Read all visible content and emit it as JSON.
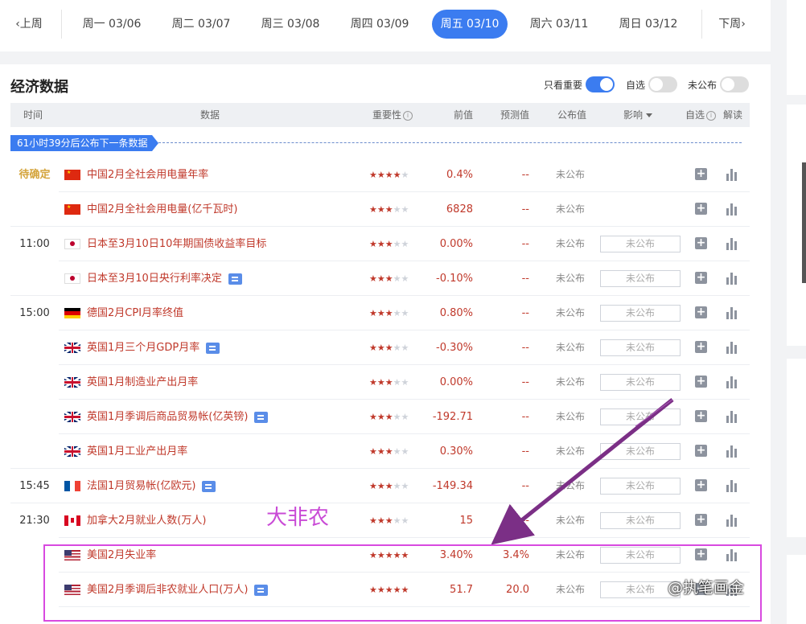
{
  "week_nav": {
    "prev": "上周",
    "next": "下周",
    "days": [
      {
        "label": "周一 03/06",
        "active": false
      },
      {
        "label": "周二 03/07",
        "active": false
      },
      {
        "label": "周三 03/08",
        "active": false
      },
      {
        "label": "周四 03/09",
        "active": false
      },
      {
        "label": "周五 03/10",
        "active": true
      },
      {
        "label": "周六 03/11",
        "active": false
      },
      {
        "label": "周日 03/12",
        "active": false
      }
    ]
  },
  "section": {
    "title": "经济数据",
    "toggles": [
      {
        "label": "只看重要",
        "on": true
      },
      {
        "label": "自选",
        "on": false
      },
      {
        "label": "未公布",
        "on": false
      }
    ]
  },
  "table": {
    "headers": {
      "time": "时间",
      "data": "数据",
      "importance": "重要性",
      "previous": "前值",
      "forecast": "预测值",
      "actual": "公布值",
      "impact": "影响",
      "watch": "自选",
      "interpret": "解读"
    },
    "countdown": "61小时39分后公布下一条数据",
    "rows": [
      {
        "time": "待确定",
        "flag": "cn",
        "name": "中国2月全社会用电量年率",
        "news": false,
        "stars": 4,
        "previous": "0.4%",
        "forecast": "--",
        "actual": "未公布",
        "impact": ""
      },
      {
        "time": "",
        "flag": "cn",
        "name": "中国2月全社会用电量(亿千瓦时)",
        "news": false,
        "stars": 3,
        "previous": "6828",
        "forecast": "--",
        "actual": "未公布",
        "impact": ""
      },
      {
        "time": "11:00",
        "flag": "jp",
        "name": "日本至3月10日10年期国债收益率目标",
        "news": false,
        "stars": 3,
        "previous": "0.00%",
        "forecast": "--",
        "actual": "未公布",
        "impact": "未公布"
      },
      {
        "time": "",
        "flag": "jp",
        "name": "日本至3月10日央行利率决定",
        "news": true,
        "stars": 3,
        "previous": "-0.10%",
        "forecast": "--",
        "actual": "未公布",
        "impact": "未公布"
      },
      {
        "time": "15:00",
        "flag": "de",
        "name": "德国2月CPI月率终值",
        "news": false,
        "stars": 3,
        "previous": "0.80%",
        "forecast": "--",
        "actual": "未公布",
        "impact": "未公布"
      },
      {
        "time": "",
        "flag": "gb",
        "name": "英国1月三个月GDP月率",
        "news": true,
        "stars": 3,
        "previous": "-0.30%",
        "forecast": "--",
        "actual": "未公布",
        "impact": "未公布"
      },
      {
        "time": "",
        "flag": "gb",
        "name": "英国1月制造业产出月率",
        "news": false,
        "stars": 3,
        "previous": "0.00%",
        "forecast": "--",
        "actual": "未公布",
        "impact": "未公布"
      },
      {
        "time": "",
        "flag": "gb",
        "name": "英国1月季调后商品贸易帐(亿英镑)",
        "news": true,
        "stars": 3,
        "previous": "-192.71",
        "forecast": "--",
        "actual": "未公布",
        "impact": "未公布"
      },
      {
        "time": "",
        "flag": "gb",
        "name": "英国1月工业产出月率",
        "news": false,
        "stars": 3,
        "previous": "0.30%",
        "forecast": "--",
        "actual": "未公布",
        "impact": "未公布"
      },
      {
        "time": "15:45",
        "flag": "fr",
        "name": "法国1月贸易帐(亿欧元)",
        "news": true,
        "stars": 3,
        "previous": "-149.34",
        "forecast": "--",
        "actual": "未公布",
        "impact": "未公布"
      },
      {
        "time": "21:30",
        "flag": "ca",
        "name": "加拿大2月就业人数(万人)",
        "news": false,
        "stars": 3,
        "previous": "15",
        "forecast": "--",
        "actual": "未公布",
        "impact": "未公布"
      },
      {
        "time": "",
        "flag": "us",
        "name": "美国2月失业率",
        "news": false,
        "stars": 5,
        "previous": "3.40%",
        "forecast": "3.4%",
        "actual": "未公布",
        "impact": "未公布"
      },
      {
        "time": "",
        "flag": "us",
        "name": "美国2月季调后非农就业人口(万人)",
        "news": true,
        "stars": 5,
        "previous": "51.7",
        "forecast": "20.0",
        "actual": "未公布",
        "impact": "未公布"
      }
    ]
  },
  "annotation": {
    "label": "大非农",
    "color": "#c94bd6"
  },
  "watermark": "@执笔画金",
  "colors": {
    "accent": "#3b7cf0",
    "value_red": "#c0392b",
    "pending_gold": "#d4a43c",
    "annotation_purple": "#d84ae0"
  }
}
